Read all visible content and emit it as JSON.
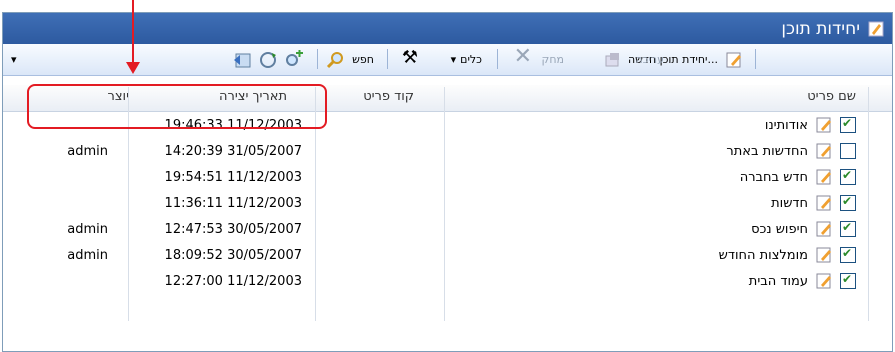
{
  "window": {
    "title": "יחידות תוכן"
  },
  "toolbar": {
    "new_item": "יחידת תוכן חדשה...",
    "edit": "עריכה",
    "delete": "מחק",
    "tools": "כלים",
    "search": "חפש"
  },
  "columns": {
    "name": "שם פריט",
    "code": "קוד פריט",
    "created": "תאריך יצירה",
    "creator": "יוצר"
  },
  "rows": [
    {
      "name": "אודותינו",
      "code": "",
      "created": "19:46:33 11/12/2003",
      "creator": "",
      "checked": true
    },
    {
      "name": "החדשות באתר",
      "code": "",
      "created": "14:20:39 31/05/2007",
      "creator": "admin",
      "checked": false
    },
    {
      "name": "חדש בחברה",
      "code": "",
      "created": "19:54:51 11/12/2003",
      "creator": "",
      "checked": true
    },
    {
      "name": "חדשות",
      "code": "",
      "created": "11:36:11 11/12/2003",
      "creator": "",
      "checked": true
    },
    {
      "name": "חיפוש נכס",
      "code": "",
      "created": "12:47:53 30/05/2007",
      "creator": "admin",
      "checked": true
    },
    {
      "name": "מומלצות החודש",
      "code": "",
      "created": "18:09:52 30/05/2007",
      "creator": "admin",
      "checked": true
    },
    {
      "name": "עמוד הבית",
      "code": "",
      "created": "12:27:00 11/12/2003",
      "creator": "",
      "checked": true
    }
  ]
}
